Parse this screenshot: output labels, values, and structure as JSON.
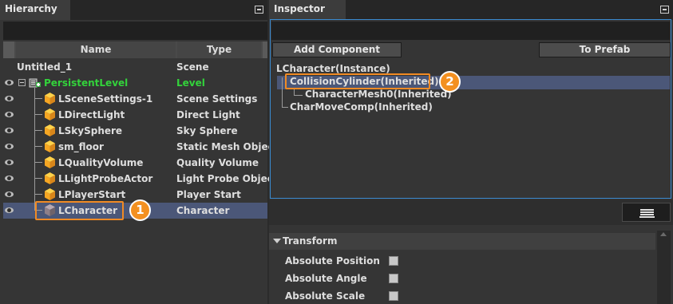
{
  "colors": {
    "accent": "#f39020",
    "selection": "#4b5778",
    "level_green": "#33d33b",
    "focus_border": "#3a8ad0",
    "cube": "#f5a623"
  },
  "hierarchy": {
    "tab_label": "Hierarchy",
    "columns": {
      "name": "Name",
      "type": "Type"
    },
    "rows": [
      {
        "name": "Untitled_1",
        "type": "Scene",
        "eye": false,
        "icon": "none"
      },
      {
        "name": "PersistentLevel",
        "type": "Level",
        "eye": true,
        "icon": "level-icon"
      },
      {
        "name": "LSceneSettings-1",
        "type": "Scene Settings",
        "eye": true,
        "icon": "cube-icon"
      },
      {
        "name": "LDirectLight",
        "type": "Direct Light",
        "eye": true,
        "icon": "cube-icon"
      },
      {
        "name": "LSkySphere",
        "type": "Sky Sphere",
        "eye": true,
        "icon": "cube-icon"
      },
      {
        "name": "sm_floor",
        "type": "Static Mesh Object",
        "eye": true,
        "icon": "cube-icon"
      },
      {
        "name": "LQualityVolume",
        "type": "Quality Volume",
        "eye": true,
        "icon": "cube-icon"
      },
      {
        "name": "LLightProbeActor",
        "type": "Light Probe Object",
        "eye": true,
        "icon": "cube-icon"
      },
      {
        "name": "LPlayerStart",
        "type": "Player Start",
        "eye": true,
        "icon": "cube-icon"
      },
      {
        "name": "LCharacter",
        "type": "Character",
        "eye": true,
        "icon": "cube-icon-gray",
        "selected": true
      }
    ],
    "badge": "1"
  },
  "inspector": {
    "tab_label": "Inspector",
    "add_component_label": "Add Component",
    "to_prefab_label": "To Prefab",
    "components": [
      {
        "label": "LCharacter(Instance)"
      },
      {
        "label": "CollisionCylinder(Inherited)",
        "selected": true
      },
      {
        "label": "CharacterMesh0(Inherited)"
      },
      {
        "label": "CharMoveComp(Inherited)"
      }
    ],
    "badge": "2",
    "transform": {
      "header": "Transform",
      "props": [
        {
          "label": "Absolute Position",
          "checked": false
        },
        {
          "label": "Absolute Angle",
          "checked": false
        },
        {
          "label": "Absolute Scale",
          "checked": false
        }
      ]
    }
  }
}
